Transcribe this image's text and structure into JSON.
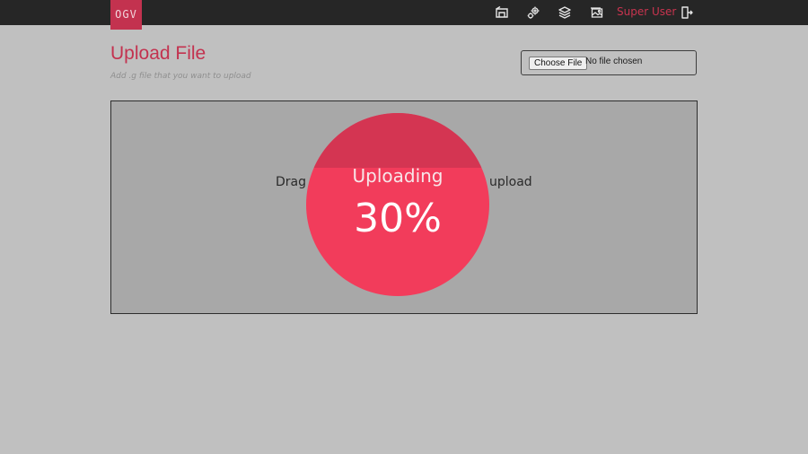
{
  "app": {
    "logo_text": "OGV"
  },
  "nav": {
    "icons": [
      "dashboard-icon",
      "settings-gears-icon",
      "layers-icon",
      "gallery-icon"
    ],
    "user_label": "Super User",
    "logout_icon": "logout-icon"
  },
  "page": {
    "title": "Upload File",
    "subtitle": "Add .g file that you want to upload"
  },
  "file_input": {
    "button_label": "Choose File",
    "status": "No file chosen"
  },
  "dropzone": {
    "text_left": "Drag",
    "text_right": "upload"
  },
  "upload": {
    "label": "Uploading",
    "percent_text": "30%",
    "progress": 0.3
  },
  "colors": {
    "accent": "#c3324f",
    "progress_bg": "#f23c5b",
    "progress_fill": "#d43552",
    "topbar": "#262626",
    "page_bg": "#c0c0c0"
  }
}
